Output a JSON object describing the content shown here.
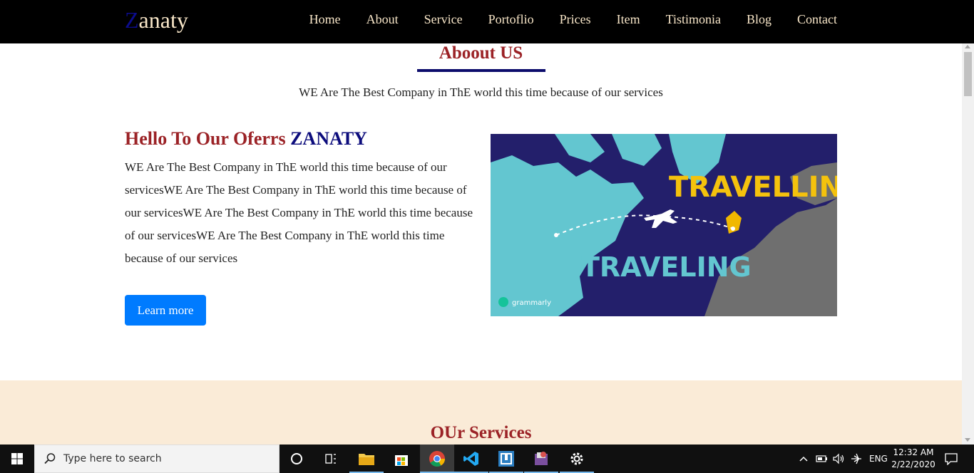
{
  "navbar": {
    "brand_first": "Z",
    "brand_rest": "anaty",
    "links": [
      "Home",
      "About",
      "Service",
      "Portoflio",
      "Prices",
      "Item",
      "Tistimonia",
      "Blog",
      "Contact"
    ]
  },
  "about": {
    "title": "Aboout US",
    "subtitle": "WE Are The Best Company in ThE world this time because of our services",
    "heading_part1": "Hello To Our Oferrs ",
    "heading_part2": "ZANATY",
    "paragraph": "WE Are The Best Company in ThE world this time because of our servicesWE Are The Best Company in ThE world this time because of our servicesWE Are The Best Company in ThE world this time because of our servicesWE Are The Best Company in ThE world this time because of our services",
    "button_label": "Learn more",
    "image": {
      "text_top": "TRAVELLING",
      "text_bottom": "TRAVELING",
      "logo_text": "grammarly"
    }
  },
  "services": {
    "title": "OUr Services"
  },
  "taskbar": {
    "search_placeholder": "Type here to search",
    "language": "ENG",
    "time": "12:32 AM",
    "date": "2/22/2020"
  },
  "colors": {
    "nav_bg": "#000000",
    "nav_text": "#f8e6c8",
    "heading_red": "#9b2226",
    "heading_blue": "#0c0c7c",
    "button_blue": "#007bff",
    "services_bg": "#faebd7"
  }
}
